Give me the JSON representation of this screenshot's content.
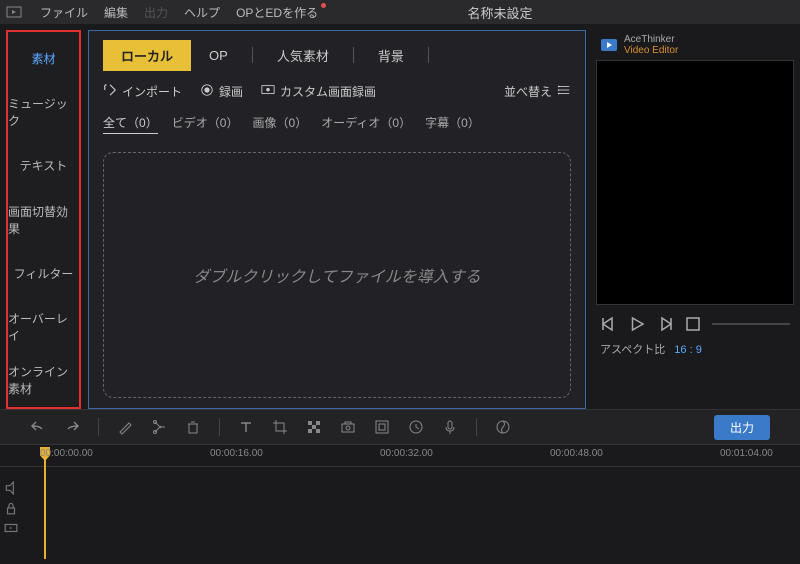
{
  "menubar": {
    "items": [
      "ファイル",
      "編集",
      "出力",
      "ヘルプ",
      "OPとEDを作る"
    ],
    "disabled_index": 2,
    "badge_index": 4,
    "title": "名称未設定"
  },
  "sidebar": {
    "items": [
      "素材",
      "ミュージック",
      "テキスト",
      "画面切替効果",
      "フィルター",
      "オーバーレイ",
      "オンライン素材"
    ],
    "active_index": 0
  },
  "mediaPanel": {
    "topTabs": [
      "ローカル",
      "OP",
      "人気素材",
      "背景"
    ],
    "topActiveIndex": 0,
    "actions": {
      "import": "インポート",
      "record": "録画",
      "customRecord": "カスタム画面録画",
      "sort": "並べ替え"
    },
    "filters": [
      {
        "label": "全て",
        "count": 0
      },
      {
        "label": "ビデオ",
        "count": 0
      },
      {
        "label": "画像",
        "count": 0
      },
      {
        "label": "オーディオ",
        "count": 0
      },
      {
        "label": "字幕",
        "count": 0
      }
    ],
    "filterActiveIndex": 0,
    "dropzone": "ダブルクリックしてファイルを導入する"
  },
  "preview": {
    "appName": "AceThinker",
    "appSub": "Video Editor",
    "aspectLabel": "アスペクト比",
    "aspectRatio": "16 : 9"
  },
  "toolbar": {
    "output": "出力"
  },
  "timeline": {
    "ticks": [
      {
        "label": "00:00:00.00",
        "pos": 40
      },
      {
        "label": "00:00:16.00",
        "pos": 210
      },
      {
        "label": "00:00:32.00",
        "pos": 380
      },
      {
        "label": "00:00:48.00",
        "pos": 550
      },
      {
        "label": "00:01:04.00",
        "pos": 720
      }
    ]
  }
}
